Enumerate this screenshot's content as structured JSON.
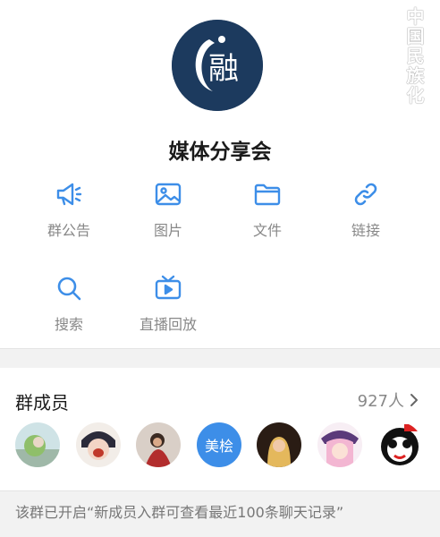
{
  "watermark": "中国民族化",
  "group": {
    "name": "媒体分享会",
    "avatar_glyph": "融"
  },
  "features": [
    {
      "label": "群公告",
      "icon": "megaphone-icon"
    },
    {
      "label": "图片",
      "icon": "image-icon"
    },
    {
      "label": "文件",
      "icon": "folder-icon"
    },
    {
      "label": "链接",
      "icon": "link-icon"
    },
    {
      "label": "搜索",
      "icon": "search-icon"
    },
    {
      "label": "直播回放",
      "icon": "tv-icon"
    }
  ],
  "members": {
    "title": "群成员",
    "count": "927人",
    "avatar_text": "美桧"
  },
  "notice": "该群已开启“新成员入群可查看最近100条聊天记录”",
  "colors": {
    "accent": "#3d8ee8",
    "avatar_bg": "#1c3a5e"
  }
}
